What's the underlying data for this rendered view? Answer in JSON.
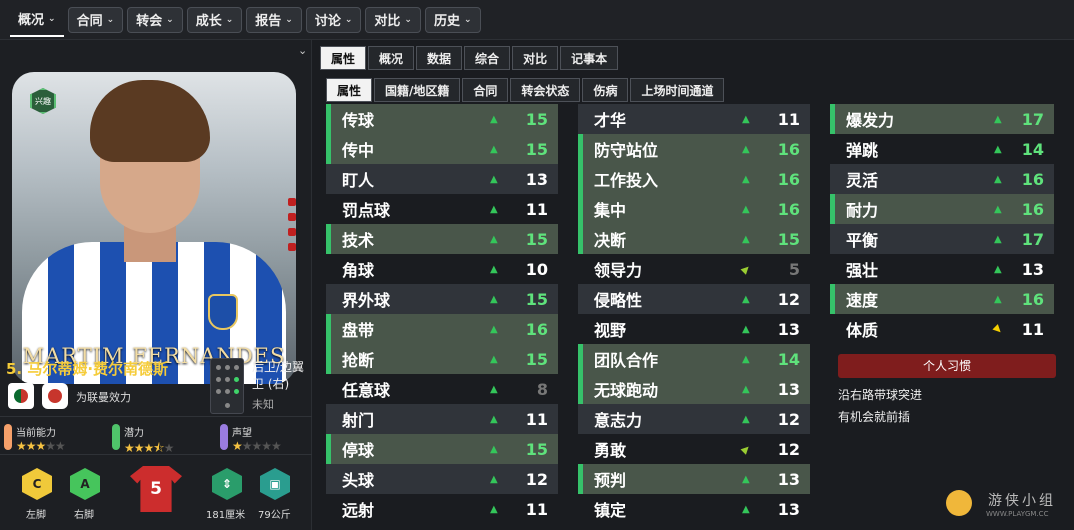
{
  "top_nav": [
    {
      "label": "概况",
      "active": true
    },
    {
      "label": "合同"
    },
    {
      "label": "转会"
    },
    {
      "label": "成长"
    },
    {
      "label": "报告"
    },
    {
      "label": "讨论"
    },
    {
      "label": "对比"
    },
    {
      "label": "历史"
    }
  ],
  "player": {
    "banner_name": "MARTIM FERNANDES",
    "number_name": "5. 马尔蒂姆·费尔南德斯",
    "interest_badge": "兴趣",
    "club": "为联曼效力",
    "position": "后卫/边翼卫 (右)",
    "foot_status": "未知",
    "current_ability": {
      "label": "当前能力",
      "stars": 3,
      "color": "#f5a06a"
    },
    "potential": {
      "label": "潜力",
      "stars": 3.5,
      "color": "#4fc36a"
    },
    "reputation": {
      "label": "声望",
      "stars": 1,
      "color": "#9a7ce0"
    },
    "left_foot": {
      "label": "左脚",
      "grade": "C",
      "color": "#f0c93a"
    },
    "right_foot": {
      "label": "右脚",
      "grade": "A",
      "color": "#46c55c"
    },
    "kit_number": "5",
    "height": "181厘米",
    "weight": "79公斤"
  },
  "tabs_main": [
    "属性",
    "概况",
    "数据",
    "综合",
    "对比",
    "记事本"
  ],
  "tabs_sub": [
    "属性",
    "国籍/地区籍",
    "合同",
    "转会状态",
    "伤病",
    "上场时间通道"
  ],
  "attributes": {
    "technical": [
      {
        "name": "传球",
        "value": 15,
        "hl": true,
        "arrow": "up"
      },
      {
        "name": "传中",
        "value": 15,
        "hl": true,
        "arrow": "up"
      },
      {
        "name": "盯人",
        "value": 13,
        "hl": false,
        "arrow": "up"
      },
      {
        "name": "罚点球",
        "value": 11,
        "hl": false,
        "arrow": "up"
      },
      {
        "name": "技术",
        "value": 15,
        "hl": true,
        "arrow": "up"
      },
      {
        "name": "角球",
        "value": 10,
        "hl": false,
        "arrow": "up"
      },
      {
        "name": "界外球",
        "value": 15,
        "hl": false,
        "arrow": "up"
      },
      {
        "name": "盘带",
        "value": 16,
        "hl": true,
        "arrow": "up"
      },
      {
        "name": "抢断",
        "value": 15,
        "hl": true,
        "arrow": "up"
      },
      {
        "name": "任意球",
        "value": 8,
        "hl": false,
        "arrow": "up"
      },
      {
        "name": "射门",
        "value": 11,
        "hl": false,
        "arrow": "up"
      },
      {
        "name": "停球",
        "value": 15,
        "hl": true,
        "arrow": "up"
      },
      {
        "name": "头球",
        "value": 12,
        "hl": false,
        "arrow": "up"
      },
      {
        "name": "远射",
        "value": 11,
        "hl": false,
        "arrow": "up"
      }
    ],
    "mental": [
      {
        "name": "才华",
        "value": 11,
        "hl": false,
        "arrow": "up"
      },
      {
        "name": "防守站位",
        "value": 16,
        "hl": true,
        "arrow": "up"
      },
      {
        "name": "工作投入",
        "value": 16,
        "hl": true,
        "arrow": "up"
      },
      {
        "name": "集中",
        "value": 16,
        "hl": true,
        "arrow": "up"
      },
      {
        "name": "决断",
        "value": 15,
        "hl": true,
        "arrow": "up"
      },
      {
        "name": "领导力",
        "value": 5,
        "hl": false,
        "arrow": "diag"
      },
      {
        "name": "侵略性",
        "value": 12,
        "hl": false,
        "arrow": "up"
      },
      {
        "name": "视野",
        "value": 13,
        "hl": false,
        "arrow": "up"
      },
      {
        "name": "团队合作",
        "value": 14,
        "hl": true,
        "arrow": "up"
      },
      {
        "name": "无球跑动",
        "value": 13,
        "hl": true,
        "arrow": "up"
      },
      {
        "name": "意志力",
        "value": 12,
        "hl": false,
        "arrow": "up"
      },
      {
        "name": "勇敢",
        "value": 12,
        "hl": false,
        "arrow": "diag"
      },
      {
        "name": "预判",
        "value": 13,
        "hl": true,
        "arrow": "up"
      },
      {
        "name": "镇定",
        "value": 13,
        "hl": false,
        "arrow": "up"
      }
    ],
    "physical": [
      {
        "name": "爆发力",
        "value": 17,
        "hl": true,
        "arrow": "up"
      },
      {
        "name": "弹跳",
        "value": 14,
        "hl": false,
        "arrow": "up"
      },
      {
        "name": "灵活",
        "value": 16,
        "hl": false,
        "arrow": "up"
      },
      {
        "name": "耐力",
        "value": 16,
        "hl": true,
        "arrow": "up"
      },
      {
        "name": "平衡",
        "value": 17,
        "hl": false,
        "arrow": "up"
      },
      {
        "name": "强壮",
        "value": 13,
        "hl": false,
        "arrow": "up"
      },
      {
        "name": "速度",
        "value": 16,
        "hl": true,
        "arrow": "up"
      },
      {
        "name": "体质",
        "value": 11,
        "hl": false,
        "arrow": "yellow"
      }
    ]
  },
  "habits": {
    "title": "个人习惯",
    "items": [
      "沿右路带球突进",
      "有机会就前插"
    ]
  },
  "watermark": {
    "text": "游侠小组",
    "sub": "WWW.PLAYGM.CC"
  }
}
